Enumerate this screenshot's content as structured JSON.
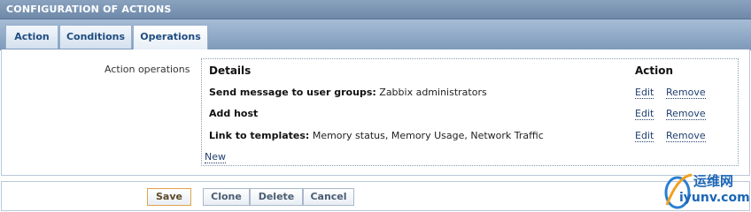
{
  "window": {
    "title": "CONFIGURATION OF ACTIONS"
  },
  "tabs": [
    {
      "label": "Action",
      "active": false
    },
    {
      "label": "Conditions",
      "active": false
    },
    {
      "label": "Operations",
      "active": true
    }
  ],
  "operations": {
    "field_label": "Action operations",
    "header_details": "Details",
    "header_action": "Action",
    "rows": [
      {
        "bold": "Send message to user groups:",
        "text": " Zabbix administrators",
        "edit": "Edit",
        "remove": "Remove"
      },
      {
        "bold": "Add host",
        "text": "",
        "edit": "Edit",
        "remove": "Remove"
      },
      {
        "bold": "Link to templates:",
        "text": " Memory status, Memory Usage, Network Traffic",
        "edit": "Edit",
        "remove": "Remove"
      }
    ],
    "new_link": "New"
  },
  "buttons": {
    "save": "Save",
    "clone": "Clone",
    "delete": "Delete",
    "cancel": "Cancel"
  },
  "watermark": {
    "line1": "运维网",
    "line2": "iyunv.com"
  },
  "colors": {
    "header_bar": "#7890b0",
    "link": "#1f3f6e",
    "save_border": "#e2a34b"
  }
}
